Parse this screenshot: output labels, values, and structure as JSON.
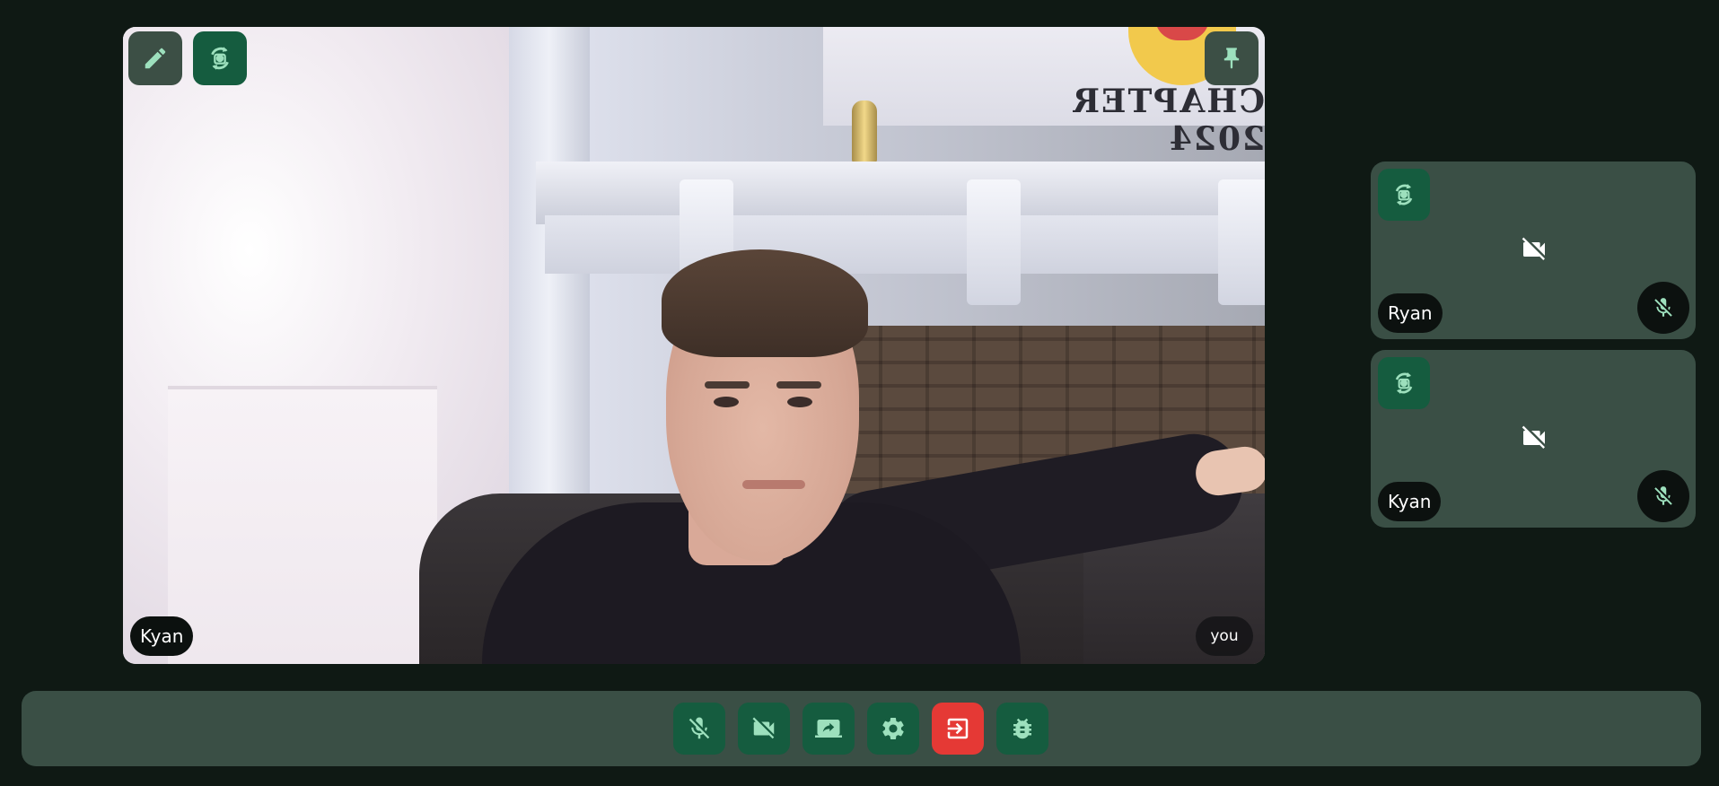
{
  "main_video": {
    "participant_name": "Kyan",
    "self_label": "you",
    "banner_text": "CHAPTER 2024",
    "controls": {
      "edit_icon": "pencil-icon",
      "rotate_icon": "camera-rotate-icon",
      "pin_icon": "pin-icon"
    }
  },
  "side_tiles": [
    {
      "name": "Ryan",
      "camera": "off",
      "mic": "muted"
    },
    {
      "name": "Kyan",
      "camera": "off",
      "mic": "muted"
    }
  ],
  "toolbar": {
    "buttons": [
      {
        "icon": "mic-off-icon"
      },
      {
        "icon": "video-off-icon"
      },
      {
        "icon": "screen-share-icon"
      },
      {
        "icon": "settings-gear-icon"
      },
      {
        "icon": "leave-call-icon"
      },
      {
        "icon": "bug-report-icon"
      }
    ]
  },
  "colors": {
    "background": "#0f1914",
    "panel": "#3a4f45",
    "accent": "#155c3f",
    "icon_tint": "#9de0bd",
    "danger": "#e53935"
  }
}
